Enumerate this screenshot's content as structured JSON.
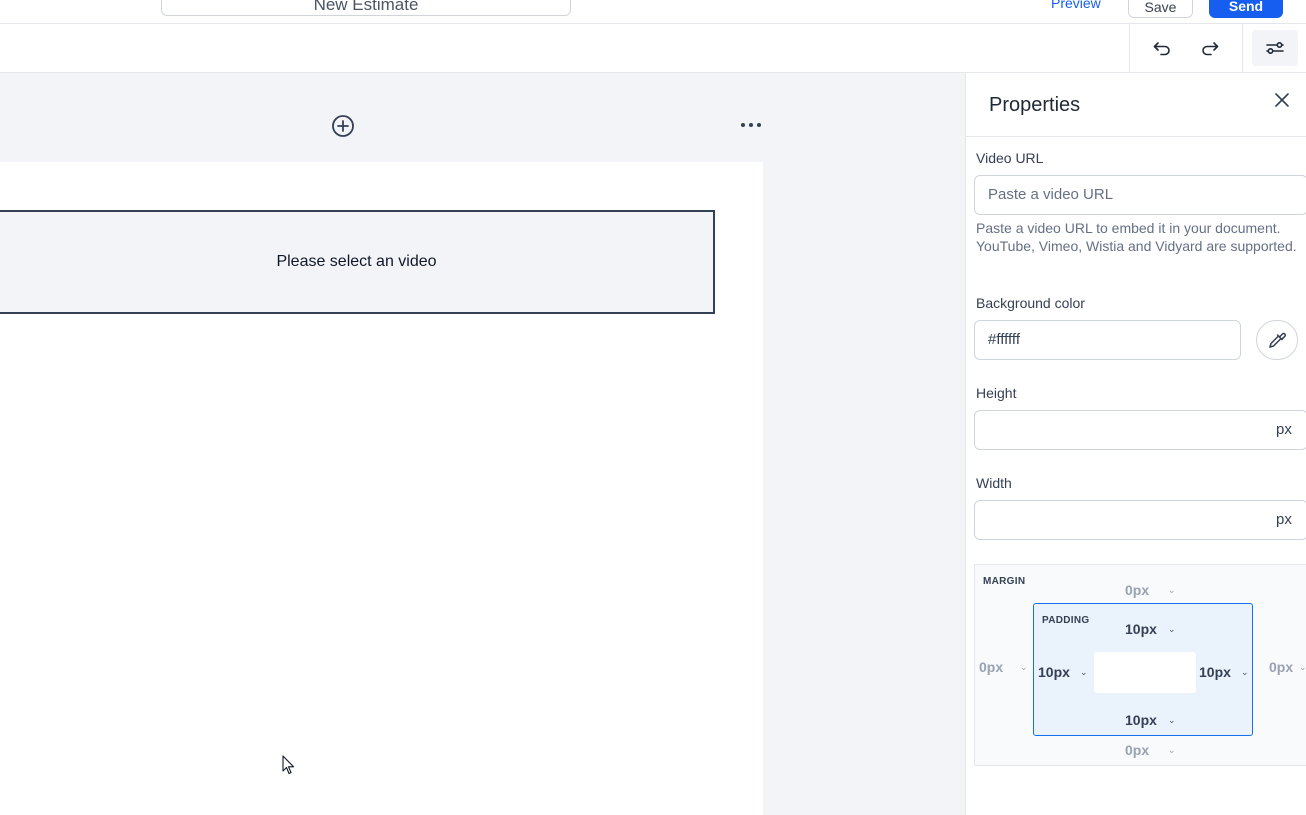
{
  "header": {
    "document_title": "New Estimate",
    "more_icon": "kebab-vertical-icon",
    "preview_label": "Preview",
    "save_label": "Save",
    "send_label": "Send",
    "accent_color": "#155eef"
  },
  "toolbar": {
    "undo_icon": "undo-icon",
    "redo_icon": "redo-icon",
    "settings_icon": "sliders-icon"
  },
  "canvas": {
    "add_icon": "plus-circle-icon",
    "more_icon": "more-horizontal-icon",
    "video_placeholder": "Please select an video"
  },
  "properties": {
    "title": "Properties",
    "video_url_label": "Video URL",
    "video_url_placeholder": "Paste a video URL",
    "video_url_help": "Paste a video URL to embed it in your document. YouTube, Vimeo, Wistia and Vidyard are supported.",
    "background_color_label": "Background color",
    "background_color_value": "#ffffff",
    "height_label": "Height",
    "height_value": "",
    "height_unit": "px",
    "width_label": "Width",
    "width_value": "",
    "width_unit": "px",
    "spacing": {
      "margin_label": "MARGIN",
      "padding_label": "PADDING",
      "margin_top": "0px",
      "margin_bottom": "0px",
      "margin_left": "0px",
      "margin_right": "0px",
      "padding_top": "10px",
      "padding_bottom": "10px",
      "padding_left": "10px",
      "padding_right": "10px"
    }
  }
}
